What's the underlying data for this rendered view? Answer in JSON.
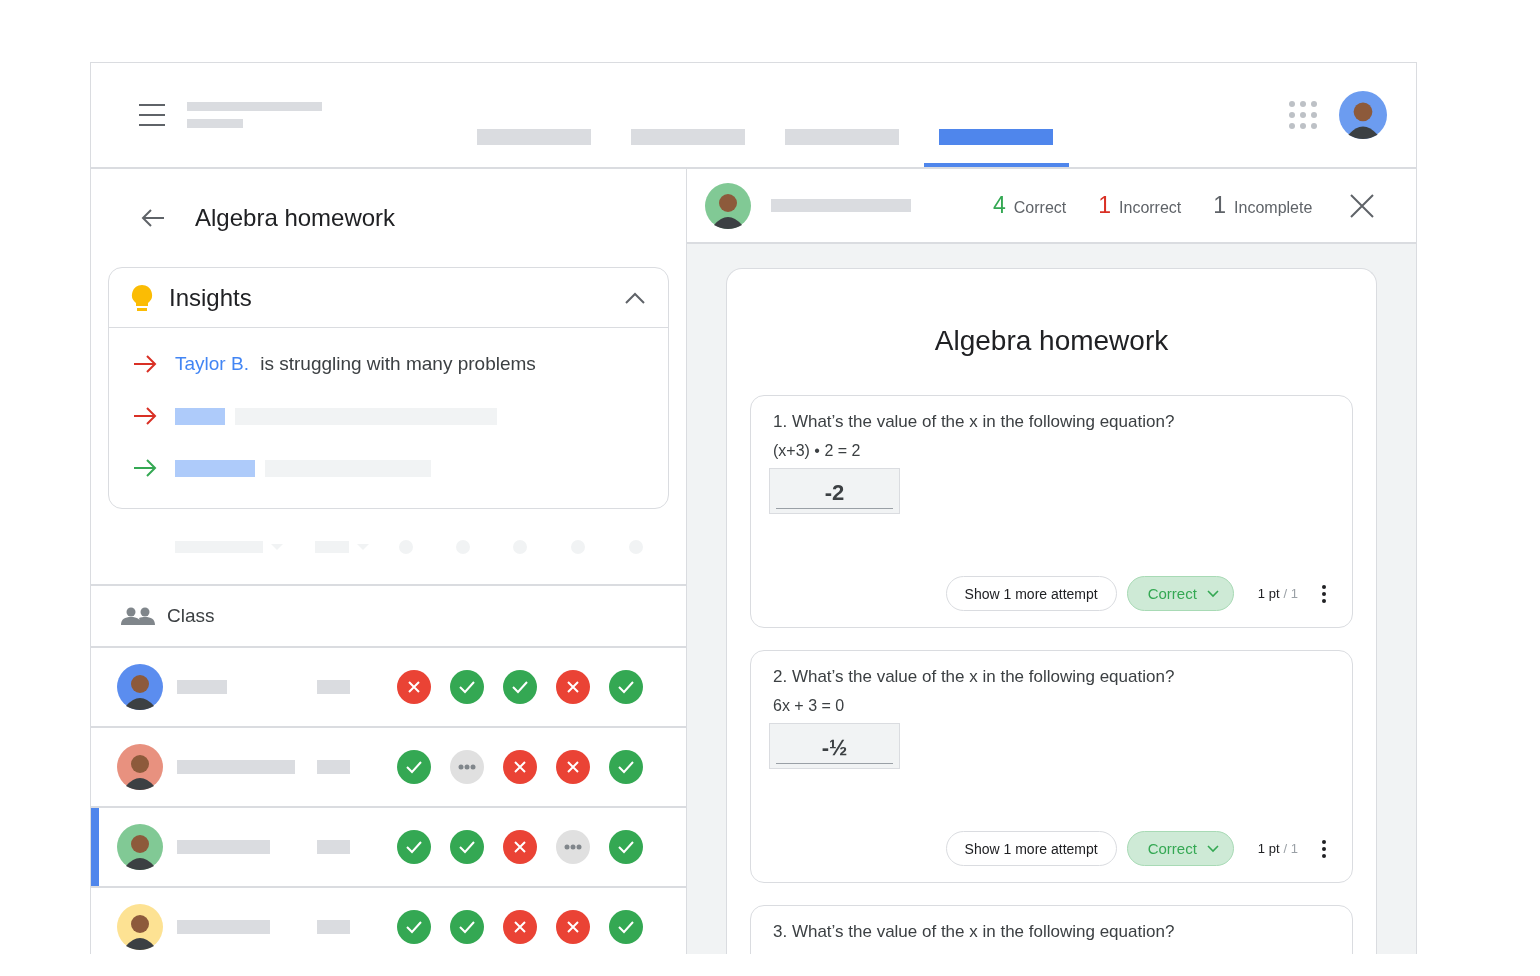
{
  "header": {
    "tabs": [
      {
        "selected": false
      },
      {
        "selected": false
      },
      {
        "selected": false
      },
      {
        "selected": true
      }
    ]
  },
  "assignment": {
    "title": "Algebra homework"
  },
  "insights": {
    "title": "Insights",
    "expanded": true,
    "items": [
      {
        "kind": "text",
        "color": "#d93025",
        "link": "Taylor B.",
        "text": "is struggling with many problems"
      },
      {
        "kind": "placeholder",
        "color": "#d93025"
      },
      {
        "kind": "placeholder",
        "color": "#34a853"
      }
    ]
  },
  "class": {
    "title": "Class",
    "students": [
      {
        "color": "#5b8def",
        "selected": false,
        "results": [
          {
            "kind": "incorrect"
          },
          {
            "kind": "correct"
          },
          {
            "kind": "correct"
          },
          {
            "kind": "incorrect"
          },
          {
            "kind": "correct"
          }
        ]
      },
      {
        "color": "#e8917f",
        "selected": false,
        "results": [
          {
            "kind": "correct"
          },
          {
            "kind": "incomplete"
          },
          {
            "kind": "incorrect"
          },
          {
            "kind": "incorrect"
          },
          {
            "kind": "correct"
          }
        ]
      },
      {
        "color": "#81c995",
        "selected": true,
        "results": [
          {
            "kind": "correct"
          },
          {
            "kind": "correct"
          },
          {
            "kind": "incorrect"
          },
          {
            "kind": "incomplete"
          },
          {
            "kind": "correct"
          }
        ]
      },
      {
        "color": "#fde293",
        "selected": false,
        "results": [
          {
            "kind": "correct"
          },
          {
            "kind": "correct"
          },
          {
            "kind": "incorrect"
          },
          {
            "kind": "incorrect"
          },
          {
            "kind": "correct"
          }
        ]
      }
    ]
  },
  "student_panel": {
    "stats": [
      {
        "count": "4",
        "label": "Correct",
        "color": "#34a853"
      },
      {
        "count": "1",
        "label": "Incorrect",
        "color": "#d93025"
      },
      {
        "count": "1",
        "label": "Incomplete",
        "color": "#5f6368"
      }
    ],
    "title": "Algebra homework",
    "questions": [
      {
        "question": "1. What’s the value of the x in the following equation?",
        "equation": "(x+3) • 2 = 2",
        "answer": "-2",
        "attempt_button": "Show 1 more attempt",
        "grade": "Correct",
        "points": "1 pt",
        "max": "/ 1"
      },
      {
        "question": "2. What’s the value of the x in the following equation?",
        "equation": "6x + 3 = 0",
        "answer": "-½",
        "attempt_button": "Show 1 more attempt",
        "grade": "Correct",
        "points": "1 pt",
        "max": "/ 1"
      },
      {
        "question": "3. What’s the value of the x in the following equation?"
      }
    ]
  }
}
